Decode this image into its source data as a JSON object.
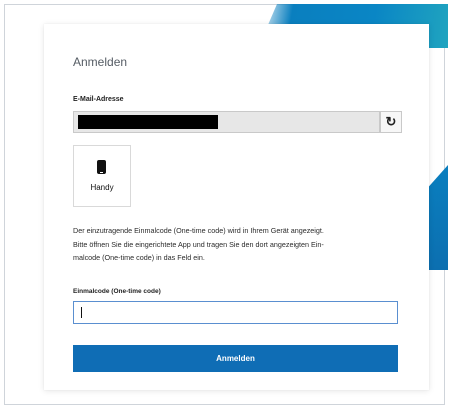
{
  "login": {
    "title": "Anmelden",
    "email_label": "E-Mail-Adresse",
    "email_value": "",
    "refresh_icon": "refresh-icon",
    "device": {
      "icon": "phone-icon",
      "label": "Handy"
    },
    "info_line1": "Der einzutragende Einmalcode (One-time code) wird in Ihrem Gerät angezeigt.",
    "info_line2": "Bitte öffnen Sie die eingerichtete App und tragen Sie den dort angezeigten Ein-",
    "info_line3": "malcode (One-time code) in das Feld ein.",
    "otp_label": "Einmalcode (One-time code)",
    "otp_value": "",
    "submit_label": "Anmelden"
  },
  "colors": {
    "accent": "#0f6db5",
    "decoration": "#0a7fbf",
    "redaction": "#000000"
  }
}
